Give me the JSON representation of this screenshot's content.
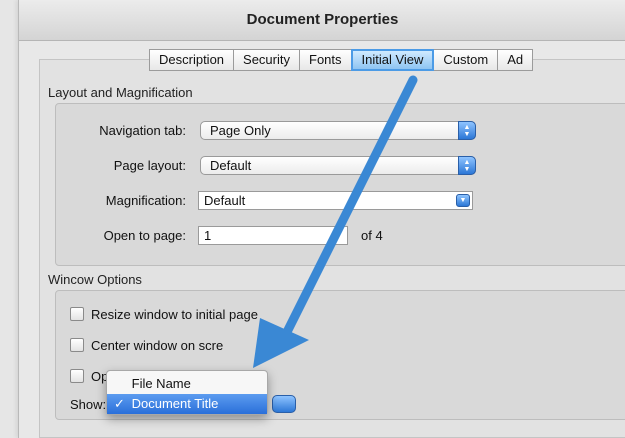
{
  "window": {
    "title": "Document Properties"
  },
  "tabs": [
    {
      "label": "Description"
    },
    {
      "label": "Security"
    },
    {
      "label": "Fonts"
    },
    {
      "label": "Initial View"
    },
    {
      "label": "Custom"
    },
    {
      "label": "Ad"
    }
  ],
  "active_tab": "Initial View",
  "layout_section": {
    "title": "Layout and Magnification",
    "navigation_tab": {
      "label": "Navigation tab:",
      "value": "Page Only"
    },
    "page_layout": {
      "label": "Page layout:",
      "value": "Default"
    },
    "magnification": {
      "label": "Magnification:",
      "value": "Default"
    },
    "open_to_page": {
      "label": "Open to page:",
      "value": "1",
      "suffix": "of 4"
    }
  },
  "window_options": {
    "title": "Wincow Options",
    "resize": {
      "label": "Resize window to initial page",
      "checked": false
    },
    "center": {
      "label": "Center window on scre",
      "checked": false
    },
    "open_full": {
      "label": "Op",
      "checked": false
    },
    "show_label": "Show:"
  },
  "show_menu": {
    "items": [
      {
        "label": "File Name",
        "check": ""
      },
      {
        "label": "Document Title",
        "check": "✓"
      }
    ],
    "selected": "Document Title"
  },
  "colors": {
    "accent": "#2c77d6",
    "arrow": "#3a88d4",
    "tab_active": "#8ec4f2"
  },
  "icons": {
    "stepper": "stepper-icon",
    "dropdown": "dropdown-arrow-icon",
    "checkmark": "checkmark-icon"
  }
}
